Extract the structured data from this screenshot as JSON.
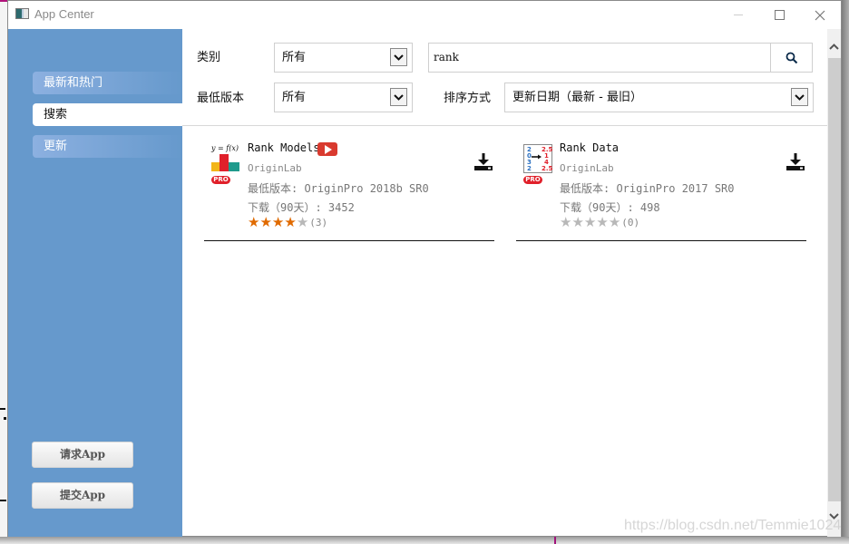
{
  "window": {
    "title": "App Center"
  },
  "sidebar": {
    "items": [
      {
        "label": "最新和热门",
        "active": false
      },
      {
        "label": "搜索",
        "active": true
      },
      {
        "label": "更新",
        "active": false
      }
    ],
    "request_app_label": "请求App",
    "submit_app_label": "提交App"
  },
  "filters": {
    "category_label": "类别",
    "category_value": "所有",
    "min_version_label": "最低版本",
    "min_version_value": "所有",
    "search_value": "rank",
    "sort_label": "排序方式",
    "sort_value": "更新日期（最新 - 最旧）"
  },
  "apps": [
    {
      "name": "Rank Models",
      "vendor": "OriginLab",
      "min_version": "最低版本: OriginPro 2018b SR0",
      "downloads": "下载（90天）: 3452",
      "rating": 4,
      "rating_max": 5,
      "rating_count": "(3)",
      "badge": "PRO",
      "has_video": true,
      "icon_caption": "y = f(x)"
    },
    {
      "name": "Rank Data",
      "vendor": "OriginLab",
      "min_version": "最低版本: OriginPro 2017 SR0",
      "downloads": "下载（90天）: 498",
      "rating": 0,
      "rating_max": 5,
      "rating_count": "(0)",
      "badge": "PRO",
      "has_video": false,
      "icon_left_values": [
        "2",
        "0",
        "3",
        "2"
      ],
      "icon_right_values": [
        "2.5",
        "1",
        "4",
        "2.5"
      ]
    }
  ],
  "colors": {
    "sidebar": "#6699cc",
    "star_on": "#e06a00",
    "star_off": "#b8b8b8",
    "pro_badge": "#e0202a",
    "video": "#d93a2f"
  },
  "watermark": "https://blog.csdn.net/Temmie1024"
}
